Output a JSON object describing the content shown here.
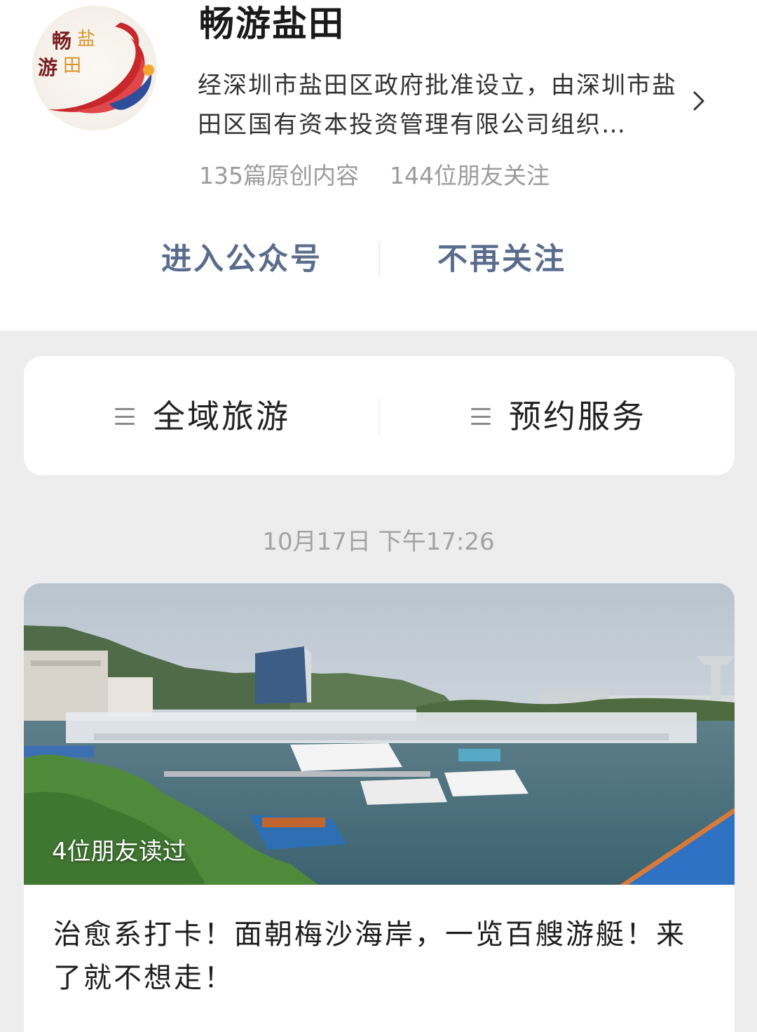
{
  "account": {
    "name": "畅游盐田",
    "description": "经深圳市盐田区政府批准设立，由深圳市盐田区国有资本投资管理有限公司组织…",
    "original_count": "135篇原创内容",
    "friends_following": "144位朋友关注",
    "logo_text": "畅游盐田",
    "avatar_icon": "logo-flame-icon",
    "chevron_icon": "chevron-right-icon"
  },
  "actions": {
    "enter_label": "进入公众号",
    "unfollow_label": "不再关注"
  },
  "menu": {
    "items": [
      {
        "label": "全域旅游",
        "icon": "menu-lines-icon"
      },
      {
        "label": "预约服务",
        "icon": "menu-lines-icon"
      }
    ]
  },
  "feed": {
    "timestamp": "10月17日 下午17:26",
    "article": {
      "read_badge": "4位朋友读过",
      "title": "治愈系打卡！面朝梅沙海岸，一览百艘游艇！来了就不想走！",
      "cover_icon": "marina-photo"
    }
  },
  "colors": {
    "link_blue": "#5a6c8c",
    "background": "#ededed",
    "card": "#ffffff",
    "muted_text": "#9b9b9b"
  }
}
